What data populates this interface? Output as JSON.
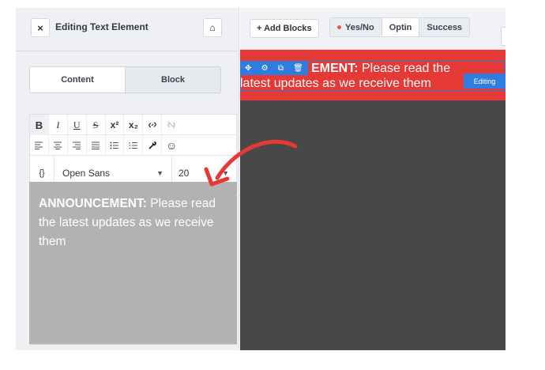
{
  "panel": {
    "title": "Editing Text Element",
    "close_glyph": "×",
    "home_glyph": "⌂",
    "tabs": [
      {
        "label": "Content",
        "active": true
      },
      {
        "label": "Block",
        "active": false
      }
    ]
  },
  "toolbar": {
    "format_buttons": [
      {
        "icon": "bold-icon",
        "glyph": "B"
      },
      {
        "icon": "italic-icon",
        "glyph": "I"
      },
      {
        "icon": "underline-icon",
        "glyph": "U"
      },
      {
        "icon": "strikethrough-icon",
        "glyph": "S"
      },
      {
        "icon": "superscript-icon",
        "glyph": "x²"
      },
      {
        "icon": "subscript-icon",
        "glyph": "x₂"
      },
      {
        "icon": "link-icon",
        "glyph": "🔗"
      },
      {
        "icon": "unlink-icon",
        "glyph": "⛓"
      }
    ],
    "align_buttons": [
      {
        "icon": "align-left-icon",
        "glyph": "≡"
      },
      {
        "icon": "align-center-icon",
        "glyph": "≡"
      },
      {
        "icon": "align-right-icon",
        "glyph": "≡"
      },
      {
        "icon": "align-justify-icon",
        "glyph": "≡"
      },
      {
        "icon": "bullet-list-icon",
        "glyph": "☰"
      },
      {
        "icon": "numbered-list-icon",
        "glyph": "☰"
      },
      {
        "icon": "color-picker-icon",
        "glyph": "✎"
      },
      {
        "icon": "emoji-icon",
        "glyph": "☺"
      }
    ],
    "braces_glyph": "{}",
    "font_family": "Open Sans",
    "font_size": "20"
  },
  "editor": {
    "bold_text": "ANNOUNCEMENT:",
    "body_text": " Please read the latest updates as we receive them"
  },
  "topbar": {
    "add_blocks": "+ Add Blocks",
    "states": [
      {
        "label": "Yes/No",
        "has_dot": true,
        "active": false
      },
      {
        "label": "Optin",
        "has_dot": false,
        "active": true
      },
      {
        "label": "Success",
        "has_dot": false,
        "active": false
      }
    ]
  },
  "preview": {
    "line1_bold": "EMENT:",
    "line1_rest": " Please read the",
    "line2": "latest updates as we receive them",
    "editing_badge": "Editing",
    "tool_glyphs": [
      "✥",
      "⚙",
      "⧉",
      "🗑"
    ]
  },
  "colors": {
    "announcement_bg": "#e53935",
    "accent_blue": "#2f7de1",
    "annotation_arrow": "#e53935",
    "editor_bg": "#b2b2b2",
    "canvas_bg": "#484848"
  }
}
